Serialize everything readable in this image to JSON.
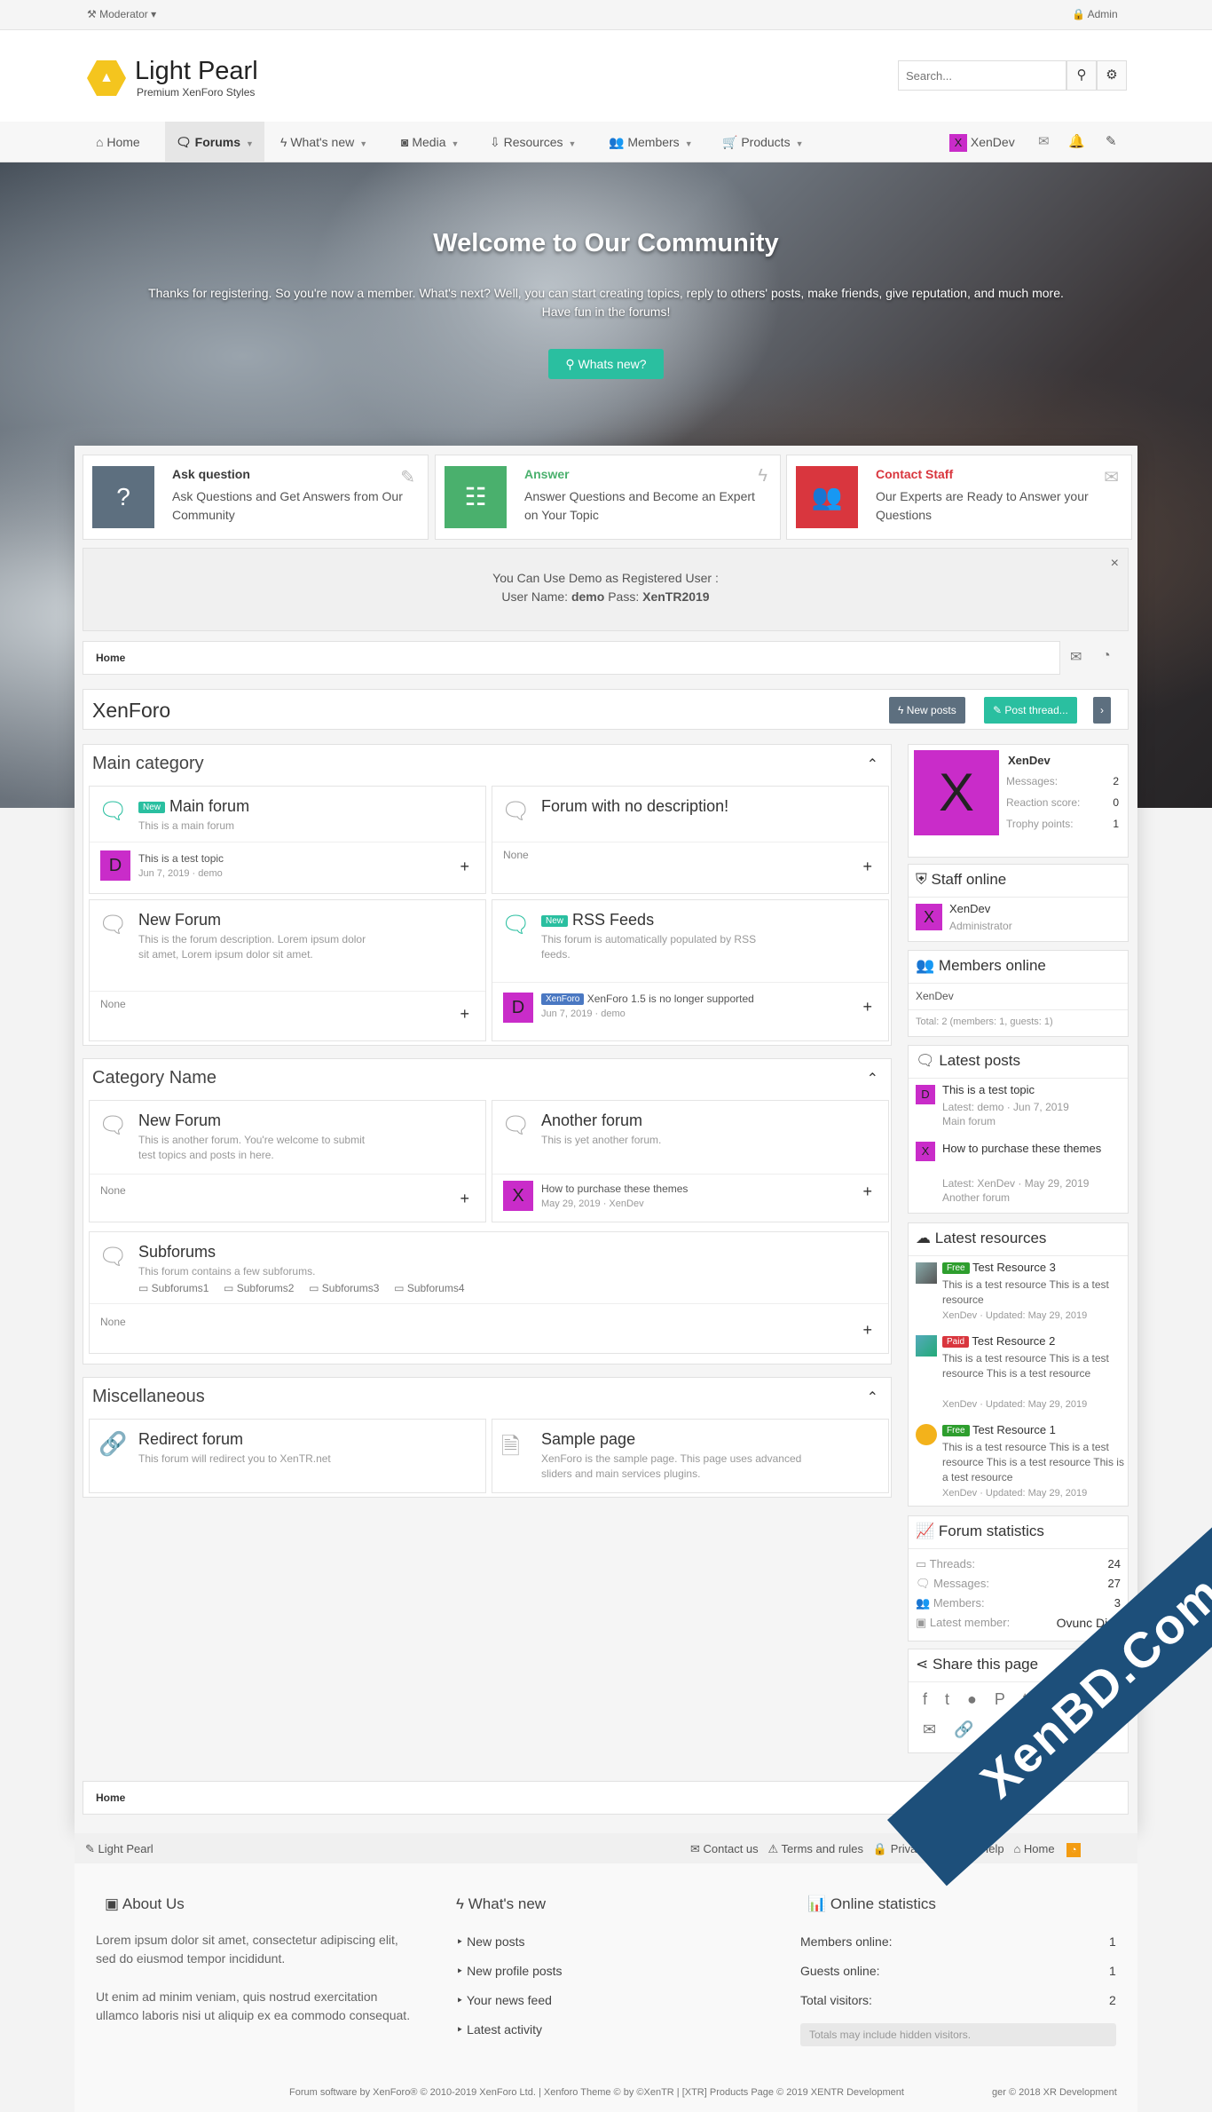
{
  "topbar": {
    "moderator": "Moderator",
    "admin": "Admin"
  },
  "logo": {
    "title": "Light Pearl",
    "subtitle": "Premium XenForo Styles"
  },
  "search": {
    "placeholder": "Search..."
  },
  "nav": [
    {
      "label": "Home",
      "icon": "home-icon"
    },
    {
      "label": "Forums",
      "icon": "comments-icon"
    },
    {
      "label": "What's new",
      "icon": "bolt-icon"
    },
    {
      "label": "Media",
      "icon": "camera-icon"
    },
    {
      "label": "Resources",
      "icon": "download-icon"
    },
    {
      "label": "Members",
      "icon": "users-icon"
    },
    {
      "label": "Products",
      "icon": "cart-icon"
    }
  ],
  "user": {
    "name": "XenDev",
    "avatar_letter": "X"
  },
  "hero": {
    "title": "Welcome to Our Community",
    "text1": "Thanks for registering. So you're now a member. What's next? Well, you can start creating topics, reply to others' posts, make friends, give reputation, and much more.",
    "text2": "Have fun in the forums!",
    "button": "Whats new?"
  },
  "features": [
    {
      "title": "Ask question",
      "desc": "Ask Questions and Get Answers from Our Community",
      "color": "#5d6f7f",
      "title_color": "#333"
    },
    {
      "title": "Answer",
      "desc": "Answer Questions and Become an Expert on Your Topic",
      "color": "#4ab06d",
      "title_color": "#4ab06d"
    },
    {
      "title": "Contact Staff",
      "desc": "Our Experts are Ready to Answer your Questions",
      "color": "#d9363e",
      "title_color": "#d9363e"
    }
  ],
  "notice": {
    "line1": "You Can Use Demo as Registered User :",
    "user_label": "User Name:",
    "user": "demo",
    "pass_label": "Pass:",
    "pass": "XenTR2019"
  },
  "breadcrumb": "Home",
  "page_title": "XenForo",
  "buttons": {
    "new_posts": "New posts",
    "post_thread": "Post thread..."
  },
  "categories": [
    {
      "title": "Main category"
    },
    {
      "title": "Category Name"
    },
    {
      "title": "Miscellaneous"
    }
  ],
  "nodes": {
    "main_forum": {
      "title": "Main forum",
      "badge": "New",
      "desc": "This is a main forum",
      "last_title": "This is a test topic",
      "last_meta": "Jun 7, 2019 · demo",
      "avatar": "D"
    },
    "no_desc": {
      "title": "Forum with no description!",
      "last": "None"
    },
    "new_forum1": {
      "title": "New Forum",
      "desc": "This is the forum description. Lorem ipsum dolor sit amet, Lorem ipsum dolor sit amet.",
      "last": "None"
    },
    "rss": {
      "title": "RSS Feeds",
      "badge": "New",
      "desc": "This forum is automatically populated by RSS feeds.",
      "prefix": "XenForo",
      "last_title": "XenForo 1.5 is no longer supported",
      "last_meta": "Jun 7, 2019 · demo",
      "avatar": "D"
    },
    "new_forum2": {
      "title": "New Forum",
      "desc": "This is another forum. You're welcome to submit test topics and posts in here.",
      "last": "None"
    },
    "another": {
      "title": "Another forum",
      "desc": "This is yet another forum.",
      "last_title": "How to purchase these themes",
      "last_meta": "May 29, 2019 · XenDev",
      "avatar": "X"
    },
    "subforums": {
      "title": "Subforums",
      "desc": "This forum contains a few subforums.",
      "subs": [
        "Subforums1",
        "Subforums2",
        "Subforums3",
        "Subforums4"
      ],
      "last": "None"
    },
    "redirect": {
      "title": "Redirect forum",
      "desc": "This forum will redirect you to XenTR.net"
    },
    "sample": {
      "title": "Sample page",
      "desc": "XenForo is the sample page. This page uses advanced sliders and main services plugins."
    }
  },
  "profile": {
    "name": "XenDev",
    "letter": "X",
    "messages_label": "Messages:",
    "messages": "2",
    "reaction_label": "Reaction score:",
    "reaction": "0",
    "trophy_label": "Trophy points:",
    "trophy": "1"
  },
  "staff": {
    "title": "Staff online",
    "name": "XenDev",
    "role": "Administrator"
  },
  "members_online": {
    "title": "Members online",
    "list": "XenDev",
    "total": "Total: 2 (members: 1, guests: 1)"
  },
  "latest_posts": {
    "title": "Latest posts",
    "items": [
      {
        "title": "This is a test topic",
        "meta": "Latest: demo · Jun 7, 2019",
        "forum": "Main forum",
        "avatar": "D"
      },
      {
        "title": "How to purchase these themes",
        "meta": "Latest: XenDev · May 29, 2019",
        "forum": "Another forum",
        "avatar": "X"
      }
    ]
  },
  "latest_resources": {
    "title": "Latest resources",
    "items": [
      {
        "badge": "Free",
        "title": "Test Resource 3",
        "desc": "This is a test resource This is a test resource",
        "meta": "XenDev · Updated: May 29, 2019"
      },
      {
        "badge": "Paid",
        "title": "Test Resource 2",
        "desc": "This is a test resource This is a test resource This is a test resource",
        "meta": "XenDev · Updated: May 29, 2019"
      },
      {
        "badge": "Free",
        "title": "Test Resource 1",
        "desc": "This is a test resource This is a test resource This is a test resource This is a test resource",
        "meta": "XenDev · Updated: May 29, 2019"
      }
    ]
  },
  "forum_stats": {
    "title": "Forum statistics",
    "rows": [
      {
        "label": "Threads:",
        "value": "24"
      },
      {
        "label": "Messages:",
        "value": "27"
      },
      {
        "label": "Members:",
        "value": "3"
      },
      {
        "label": "Latest member:",
        "value": "Ovunc Dinc"
      }
    ]
  },
  "share": {
    "title": "Share this page"
  },
  "footer_bar": {
    "left": "Light Pearl",
    "links": [
      "Contact us",
      "Terms and rules",
      "Privacy policy",
      "Help",
      "Home"
    ]
  },
  "footer": {
    "about_title": "About Us",
    "about1": "Lorem ipsum dolor sit amet, consectetur adipiscing elit, sed do eiusmod tempor incididunt.",
    "about2": "Ut enim ad minim veniam, quis nostrud exercitation ullamco laboris nisi ut aliquip ex ea commodo consequat.",
    "whatsnew_title": "What's new",
    "whatsnew_links": [
      "New posts",
      "New profile posts",
      "Your news feed",
      "Latest activity"
    ],
    "stats_title": "Online statistics",
    "stats": [
      {
        "label": "Members online:",
        "value": "1"
      },
      {
        "label": "Guests online:",
        "value": "1"
      },
      {
        "label": "Total visitors:",
        "value": "2"
      }
    ],
    "stats_note": "Totals may include hidden visitors.",
    "copyright": "Forum software by XenForo® © 2010-2019 XenForo Ltd. | Xenforo Theme © by ©XenTR | [XTR] Products Page © 2019 XENTR Development",
    "copyright2": "ger © 2018 XR Development"
  },
  "watermark": "XenBD.Com"
}
